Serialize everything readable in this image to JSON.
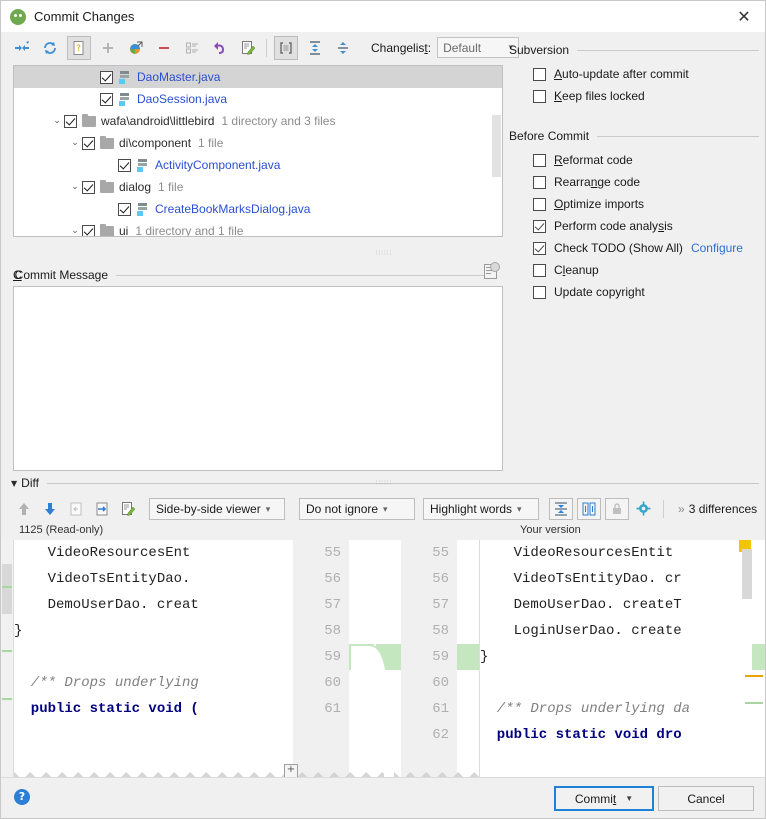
{
  "window": {
    "title": "Commit Changes",
    "title_icon": "android-commit-icon",
    "close_label": "✕"
  },
  "toolbar": {
    "buttons": [
      {
        "name": "show-diff-icon",
        "label": ""
      },
      {
        "name": "refresh-icon",
        "label": ""
      },
      {
        "name": "unversioned-files-icon",
        "label": "",
        "pressed": true
      },
      {
        "name": "add-icon",
        "label": ""
      },
      {
        "name": "move-to-another-changelist-icon",
        "label": ""
      },
      {
        "name": "delete-icon",
        "label": ""
      },
      {
        "name": "group-by-icon",
        "label": ""
      },
      {
        "name": "revert-icon",
        "label": ""
      },
      {
        "name": "edit-source-icon",
        "label": ""
      },
      {
        "name": "expand-directories-icon",
        "label": "",
        "pressed": true
      },
      {
        "name": "expand-all-icon",
        "label": ""
      },
      {
        "name": "collapse-all-icon",
        "label": ""
      }
    ],
    "changelist_label": "Changelis",
    "changelist_label_mnemonic": "t",
    "changelist_label_suffix": ":",
    "changelist_value": "Default"
  },
  "tree": {
    "rows": [
      {
        "indent": 4,
        "twisty": "",
        "checked": true,
        "kind": "java",
        "name": "DaoMaster.java",
        "meta": "",
        "selected": true
      },
      {
        "indent": 4,
        "twisty": "",
        "checked": true,
        "kind": "java",
        "name": "DaoSession.java",
        "meta": "",
        "selected": false
      },
      {
        "indent": 2,
        "twisty": "⌄",
        "checked": true,
        "kind": "folder",
        "name": "wafa\\android\\littlebird",
        "meta": "1 directory and 3 files",
        "selected": false
      },
      {
        "indent": 3,
        "twisty": "⌄",
        "checked": true,
        "kind": "folder",
        "name": "di\\component",
        "meta": "1 file",
        "selected": false
      },
      {
        "indent": 5,
        "twisty": "",
        "checked": true,
        "kind": "java",
        "name": "ActivityComponent.java",
        "meta": "",
        "selected": false
      },
      {
        "indent": 3,
        "twisty": "⌄",
        "checked": true,
        "kind": "folder",
        "name": "dialog",
        "meta": "1 file",
        "selected": false
      },
      {
        "indent": 5,
        "twisty": "",
        "checked": true,
        "kind": "java",
        "name": "CreateBookMarksDialog.java",
        "meta": "",
        "selected": false
      },
      {
        "indent": 3,
        "twisty": "⌄",
        "checked": true,
        "kind": "folder",
        "name": "ui",
        "meta": "1 directory and 1 file",
        "selected": false
      }
    ]
  },
  "commit_message": {
    "label_pre": "C",
    "label_mnemonic": "",
    "label": "Commit Message",
    "value": "",
    "placeholder": "",
    "history_icon": "message-history-icon"
  },
  "options": {
    "groups": [
      {
        "title": "Subversion",
        "items": [
          {
            "label": "Auto-update after commit",
            "checked": false,
            "mnemonic": "A"
          },
          {
            "label": "Keep files locked",
            "checked": false,
            "mnemonic": "K"
          }
        ]
      },
      {
        "title": "Before Commit",
        "items": [
          {
            "label": "Reformat code",
            "checked": false,
            "mnemonic": "R"
          },
          {
            "label": "Rearrange code",
            "checked": false,
            "mnemonic": "n"
          },
          {
            "label": "Optimize imports",
            "checked": false,
            "mnemonic": "O"
          },
          {
            "label": "Perform code analysis",
            "checked": true,
            "mnemonic": "s"
          },
          {
            "label": "Check TODO (Show All)",
            "checked": true,
            "mnemonic": "",
            "link": "Configure"
          },
          {
            "label": "Cleanup",
            "checked": false,
            "mnemonic": "l"
          },
          {
            "label": "Update copyright",
            "checked": false,
            "mnemonic": ""
          }
        ]
      }
    ]
  },
  "diff": {
    "section_title": "Diff",
    "toolbar": {
      "prev_diff_icon": "arrow-up-icon",
      "next_diff_icon": "arrow-down-icon",
      "accept_left_icon": "accept-left-icon",
      "accept_right_icon": "accept-right-icon",
      "editor_icon": "edit-source-icon",
      "viewer_mode": "Side-by-side viewer",
      "ignore_mode": "Do not ignore",
      "highlight_mode": "Highlight words",
      "collapse_unchanged_icon": "collapse-unchanged-icon",
      "synchronize_icon": "synchronize-scroll-icon",
      "readonly_icon": "lock-icon",
      "settings_icon": "gear-icon",
      "differences_text": "3 differences",
      "more_chevron": "»"
    },
    "left_pane_label": "1125 (Read-only)",
    "right_pane_label": "Your version",
    "left_lines": [
      {
        "num": "55",
        "text": "    VideoResourcesEnt"
      },
      {
        "num": "56",
        "text": "    VideoTsEntityDao."
      },
      {
        "num": "57",
        "text": "    DemoUserDao. creat"
      },
      {
        "num": "58",
        "text": "}"
      },
      {
        "num": "59",
        "text": ""
      },
      {
        "num": "60",
        "text": "  /** Drops underlying"
      },
      {
        "num": "61",
        "text": "  public static void ("
      }
    ],
    "right_lines": [
      {
        "num": "55",
        "text": "    VideoResourcesEntit"
      },
      {
        "num": "56",
        "text": "    VideoTsEntityDao. cr"
      },
      {
        "num": "57",
        "text": "    DemoUserDao. createT"
      },
      {
        "num": "58",
        "text": "    LoginUserDao. create",
        "added": true
      },
      {
        "num": "59",
        "text": "}"
      },
      {
        "num": "60",
        "text": ""
      },
      {
        "num": "61",
        "text": "  /** Drops underlying da"
      },
      {
        "num": "62",
        "text": "  public static void dro"
      }
    ]
  },
  "bottom": {
    "help_icon": "help-icon",
    "help_label": "?",
    "commit_label": "Commi",
    "commit_mnemonic": "t",
    "commit_dropdown_icon": "chevron-down-icon",
    "cancel_label": "Cancel"
  },
  "colors": {
    "accent_blue": "#2b7fd4",
    "link_blue": "#2b6fd1",
    "added_green": "#c5e7c0",
    "file_blue": "#2b4fd1",
    "marker_yellow": "#f5c400",
    "marker_orange": "#e8a400"
  }
}
